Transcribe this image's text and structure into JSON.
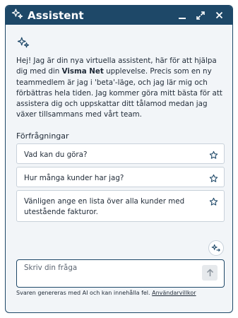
{
  "header": {
    "title": "Assistent",
    "icons": [
      "sparkle-icon",
      "minimize-icon",
      "expand-icon",
      "close-icon"
    ]
  },
  "intro": {
    "part1": "Hej! Jag är din nya virtuella assistent, här för att hjälpa dig med din ",
    "brand": "Visma Net",
    "part2": " upplevelse. Precis som en ny teammedlem är jag i 'beta'-läge, och jag lär mig och förbättras hela tiden. Jag kommer göra mitt bästa för att assistera dig och uppskattar ditt tålamod medan jag växer tillsammans med vårt team."
  },
  "requests": {
    "title": "Förfrågningar",
    "items": [
      {
        "label": "Vad kan du göra?"
      },
      {
        "label": "Hur många kunder har jag?"
      },
      {
        "label": "Vänligen ange en lista över alla kunder med utestående fakturor."
      }
    ]
  },
  "composer": {
    "placeholder": "Skriv din fråga"
  },
  "footer": {
    "text": "Svaren genereras med AI och kan innehålla fel. ",
    "link": "Användarvillkor"
  },
  "colors": {
    "accent": "#1e4868",
    "background": "#f2f5f8"
  }
}
